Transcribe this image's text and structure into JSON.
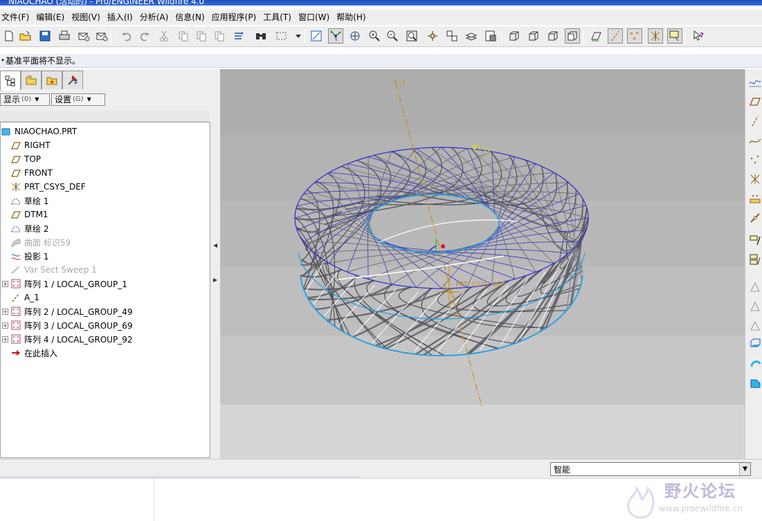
{
  "window": {
    "title": "NIAOCHAO (活动的) - Pro/ENGINEER Wildfire 4.0"
  },
  "menu": [
    {
      "label": "文件(F)"
    },
    {
      "label": "编辑(E)"
    },
    {
      "label": "视图(V)"
    },
    {
      "label": "插入(I)"
    },
    {
      "label": "分析(A)"
    },
    {
      "label": "信息(N)"
    },
    {
      "label": "应用程序(P)"
    },
    {
      "label": "工具(T)"
    },
    {
      "label": "窗口(W)"
    },
    {
      "label": "帮助(H)"
    }
  ],
  "message": {
    "text": "基准平面将不显示。"
  },
  "panel": {
    "show_label": "显示",
    "show_hotkey": "(0)",
    "settings_label": "设置",
    "settings_hotkey": "(G)"
  },
  "tree": {
    "items": [
      {
        "label": "NIAOCHAO.PRT",
        "icon": "part-icon",
        "dim": false,
        "expander": false
      },
      {
        "label": "RIGHT",
        "icon": "datum-plane-icon",
        "dim": false,
        "expander": false
      },
      {
        "label": "TOP",
        "icon": "datum-plane-icon",
        "dim": false,
        "expander": false
      },
      {
        "label": "FRONT",
        "icon": "datum-plane-icon",
        "dim": false,
        "expander": false
      },
      {
        "label": "PRT_CSYS_DEF",
        "icon": "coordinate-system-icon",
        "dim": false,
        "expander": false
      },
      {
        "label": "草绘 1",
        "icon": "sketch-icon",
        "dim": false,
        "expander": false
      },
      {
        "label": "DTM1",
        "icon": "datum-plane-icon",
        "dim": false,
        "expander": false
      },
      {
        "label": "草绘 2",
        "icon": "sketch-icon",
        "dim": false,
        "expander": false
      },
      {
        "label": "曲面 标识59",
        "icon": "surface-icon",
        "dim": true,
        "expander": false
      },
      {
        "label": "投影 1",
        "icon": "projection-icon",
        "dim": false,
        "expander": false
      },
      {
        "label": "Var Sect Sweep 1",
        "icon": "sweep-icon",
        "dim": true,
        "expander": false
      },
      {
        "label": "阵列 1 / LOCAL_GROUP_1",
        "icon": "pattern-icon",
        "dim": false,
        "expander": true
      },
      {
        "label": "A_1",
        "icon": "datum-axis-icon",
        "dim": false,
        "expander": false
      },
      {
        "label": "阵列 2 / LOCAL_GROUP_49",
        "icon": "pattern-icon",
        "dim": false,
        "expander": true
      },
      {
        "label": "阵列 3 / LOCAL_GROUP_69",
        "icon": "pattern-icon",
        "dim": false,
        "expander": true
      },
      {
        "label": "阵列 4 / LOCAL_GROUP_92",
        "icon": "pattern-icon",
        "dim": false,
        "expander": true
      },
      {
        "label": "在此插入",
        "icon": "insert-here-icon",
        "dim": false,
        "expander": false
      }
    ]
  },
  "graphics": {
    "axis_label": "A_1",
    "csys_label": "PRT_CSYS_DEF",
    "colors": {
      "axis": "#d08a1a",
      "blue_edges": "#2a2ad0",
      "cyan_edges": "#1e9ee6",
      "white_edges": "#ffffff",
      "gray_edges": "#707078"
    }
  },
  "status": {
    "filter_value": "智能"
  },
  "watermark": {
    "name": "野火论坛",
    "url": "www.proewildfire.cn"
  }
}
